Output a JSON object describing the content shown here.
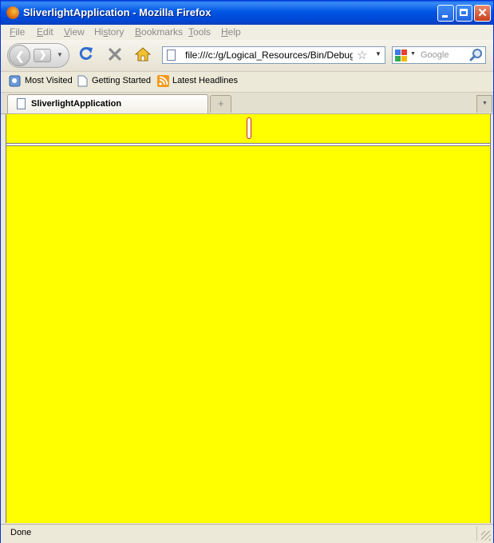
{
  "window": {
    "title": "SliverlightApplication - Mozilla Firefox",
    "controls": [
      "minimize",
      "maximize",
      "close"
    ]
  },
  "menu": {
    "items": [
      {
        "accel": "F",
        "rest": "ile"
      },
      {
        "accel": "E",
        "rest": "dit"
      },
      {
        "accel": "V",
        "rest": "iew"
      },
      {
        "accel": "",
        "pre": "Hi",
        "accel2": "s",
        "rest": "tory"
      },
      {
        "accel": "B",
        "rest": "ookmarks"
      },
      {
        "accel": "T",
        "rest": "ools"
      },
      {
        "accel": "H",
        "rest": "elp"
      }
    ]
  },
  "navigation": {
    "url": "file:///c:/g/Logical_Resources/Bin/Debug/Te",
    "search_placeholder": "Google",
    "search_engine_icon": "google-icon"
  },
  "bookmarks": {
    "items": [
      {
        "label": "Most Visited",
        "icon": "most-visited-icon"
      },
      {
        "label": "Getting Started",
        "icon": "page-icon"
      },
      {
        "label": "Latest Headlines",
        "icon": "rss-icon"
      }
    ]
  },
  "tabs": [
    {
      "label": "SliverlightApplication",
      "active": true
    }
  ],
  "content": {
    "background": "#ffff00",
    "slider_value": 0.5
  },
  "status": {
    "text": "Done"
  },
  "colors": {
    "titlebar": "#0055e5",
    "content_bg": "#ffff00",
    "slider_border": "#c8261f"
  }
}
